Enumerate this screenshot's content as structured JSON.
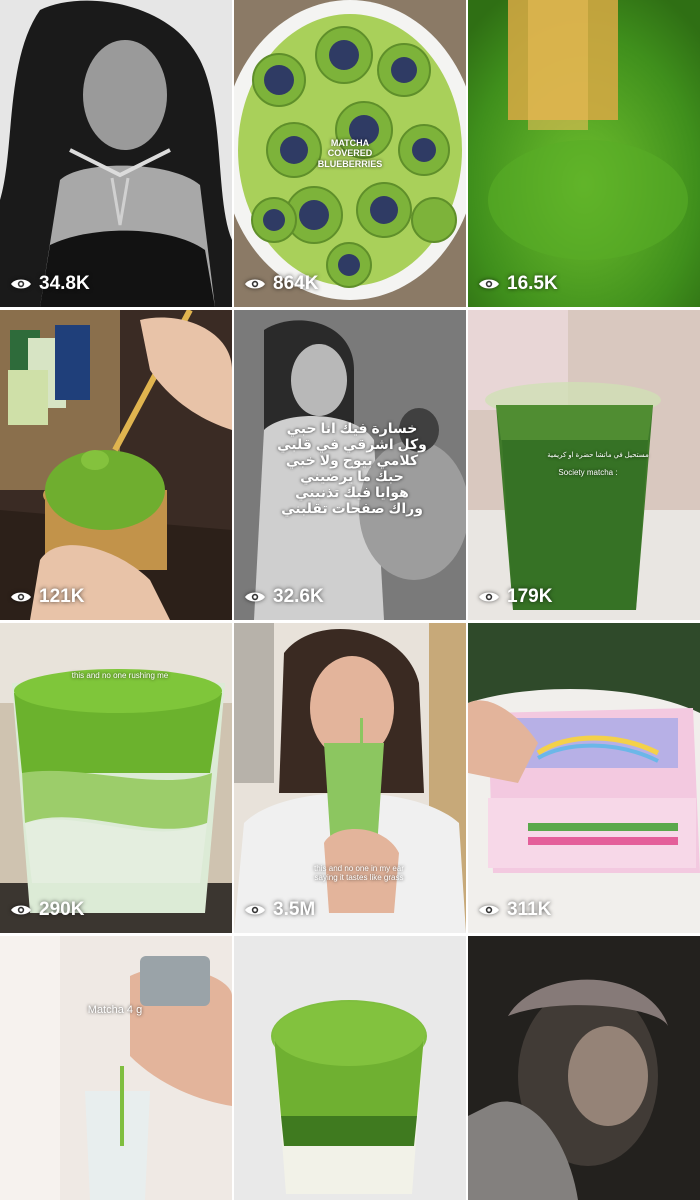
{
  "tiles": [
    {
      "views": "34.8K",
      "icon": "eye-icon"
    },
    {
      "views": "864K",
      "overlay": "MATCHA\nCOVERED\nBLUEBERRIES",
      "icon": "eye-icon"
    },
    {
      "views": "16.5K",
      "icon": "eye-icon"
    },
    {
      "views": "121K",
      "icon": "eye-icon"
    },
    {
      "views": "32.6K",
      "overlay": "خسارة فيك انا حبي\nوكل اشرقي في قلبي\nكلامي بيوح ولا خبي\nحبك ما يرضيني\nهوايا فيك تذنيني\nوراك صفحات تقلبني",
      "icon": "eye-icon"
    },
    {
      "views": "179K",
      "overlay": "مستحيل في ماتشا حضرة او كريمية",
      "overlay2": "Society matcha :",
      "icon": "eye-icon"
    },
    {
      "views": "290K",
      "overlay": "this and no one rushing me",
      "icon": "eye-icon"
    },
    {
      "views": "3.5M",
      "overlay": "this and no one in my ear\nsaying it tastes like grass",
      "icon": "eye-icon"
    },
    {
      "views": "311K",
      "icon": "eye-icon"
    },
    {
      "overlay": "Matcha 4 g"
    },
    {},
    {}
  ],
  "colors": {
    "matcha": "#7cb342",
    "matcha_dark": "#3e6b1f",
    "text": "#ffffff"
  }
}
